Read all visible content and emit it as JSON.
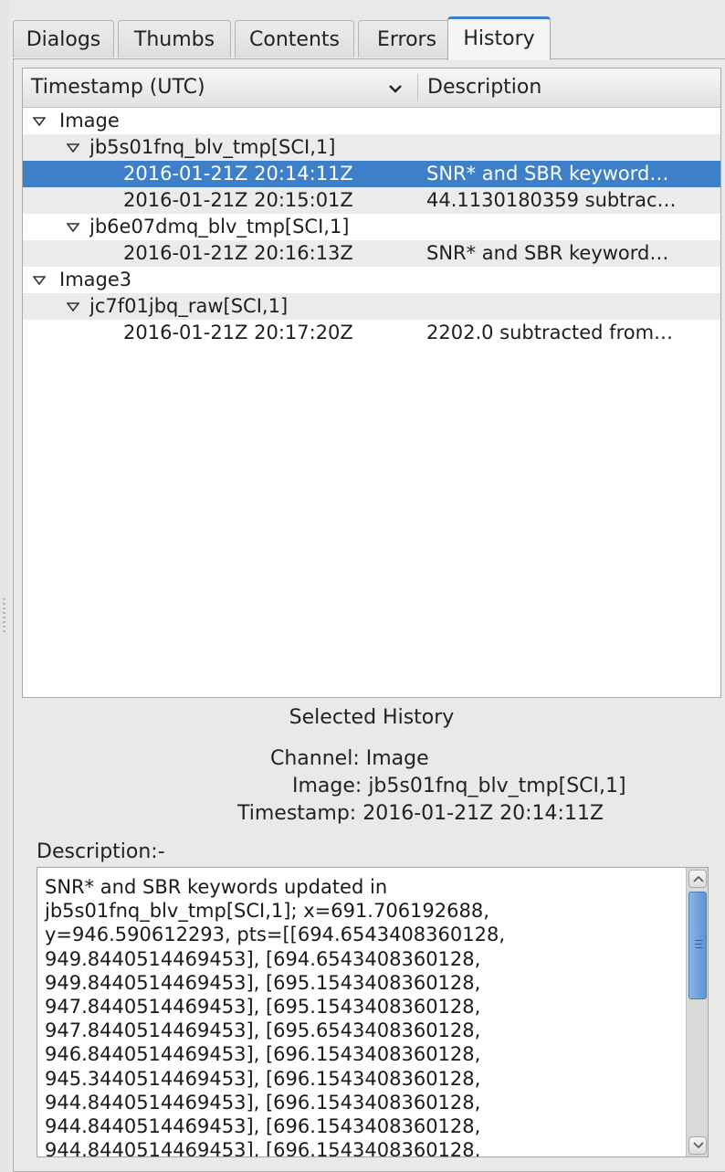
{
  "tabs": [
    {
      "label": "Dialogs",
      "active": false
    },
    {
      "label": "Thumbs",
      "active": false
    },
    {
      "label": "Contents",
      "active": false
    },
    {
      "label": "Errors",
      "active": false
    },
    {
      "label": "History",
      "active": true
    }
  ],
  "tree": {
    "columns": [
      "Timestamp (UTC)",
      "Description"
    ],
    "sort_icon": "chevron-down-icon",
    "rows": [
      {
        "type": "channel",
        "label": "Image",
        "expanded": true
      },
      {
        "type": "image",
        "label": "jb5s01fnq_blv_tmp[SCI,1]",
        "expanded": true
      },
      {
        "type": "entry",
        "timestamp": "2016-01-21Z 20:14:11Z",
        "description": "SNR* and SBR keyword…",
        "selected": true
      },
      {
        "type": "entry",
        "timestamp": "2016-01-21Z 20:15:01Z",
        "description": "44.1130180359 subtrac…"
      },
      {
        "type": "image",
        "label": "jb6e07dmq_blv_tmp[SCI,1]",
        "expanded": true
      },
      {
        "type": "entry",
        "timestamp": "2016-01-21Z 20:16:13Z",
        "description": "SNR* and SBR keyword…"
      },
      {
        "type": "channel",
        "label": "Image3",
        "expanded": true
      },
      {
        "type": "image",
        "label": "jc7f01jbq_raw[SCI,1]",
        "expanded": true
      },
      {
        "type": "entry",
        "timestamp": "2016-01-21Z 20:17:20Z",
        "description": "2202.0 subtracted from…"
      }
    ]
  },
  "selected": {
    "heading": "Selected History",
    "channel_label": "Channel:",
    "channel": "Image",
    "image_label": "Image:",
    "image": "jb5s01fnq_blv_tmp[SCI,1]",
    "timestamp_label": "Timestamp:",
    "timestamp": "2016-01-21Z 20:14:11Z",
    "description_label": "Description:-",
    "description": "SNR* and SBR keywords updated in\njb5s01fnq_blv_tmp[SCI,1]; x=691.706192688,\ny=946.590612293, pts=[[694.6543408360128,\n949.8440514469453], [694.6543408360128,\n949.8440514469453], [695.1543408360128,\n947.8440514469453], [695.1543408360128,\n947.8440514469453], [695.6543408360128,\n946.8440514469453], [696.1543408360128,\n945.3440514469453], [696.1543408360128,\n944.8440514469453], [696.1543408360128,\n944.8440514469453], [696.1543408360128,\n944.8440514469453], [696.1543408360128,",
    "scroll_position": 0.0
  },
  "colors": {
    "selection": "#3e7fc9",
    "active_tab_accent": "#3e7fca",
    "scroll_thumb": "#5e93d3"
  }
}
